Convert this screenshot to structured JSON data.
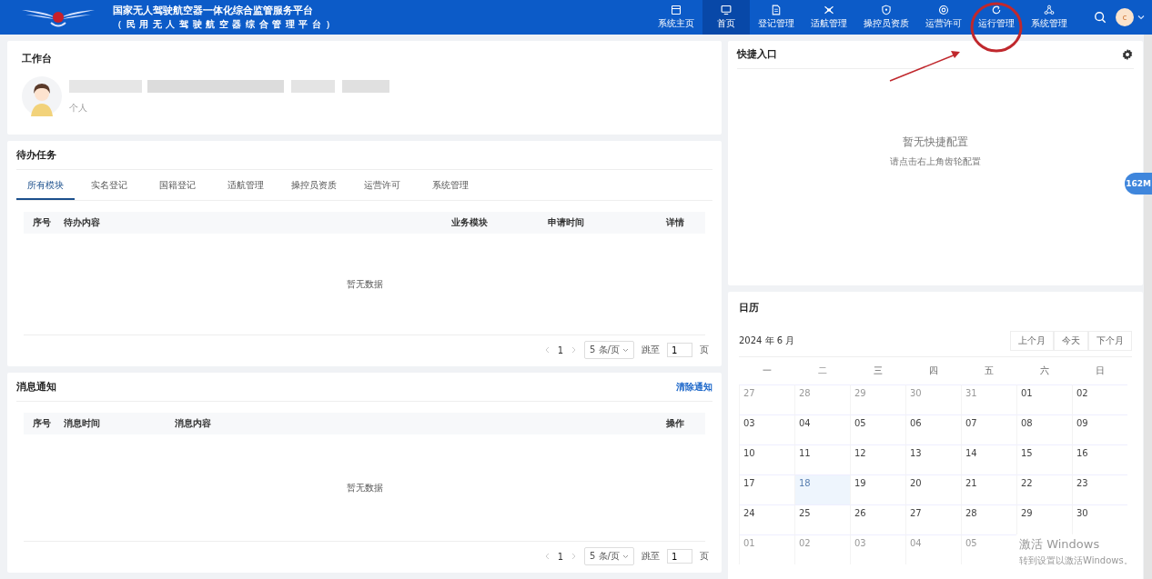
{
  "header": {
    "title": "国家无人驾驶航空器一体化综合监管服务平台",
    "subtitle": "（民用无人驾驶航空器综合管理平台）",
    "nav": [
      {
        "label": "系统主页",
        "selected": false
      },
      {
        "label": "首页",
        "selected": true
      },
      {
        "label": "登记管理",
        "selected": false
      },
      {
        "label": "适航管理",
        "selected": false
      },
      {
        "label": "操控员资质",
        "selected": false
      },
      {
        "label": "运营许可",
        "selected": false
      },
      {
        "label": "运行管理",
        "selected": false
      },
      {
        "label": "系统管理",
        "selected": false
      }
    ],
    "avatar": "c"
  },
  "workbench": {
    "title": "工作台",
    "role": "个人"
  },
  "todo": {
    "title": "待办任务",
    "tabs": [
      {
        "label": "所有模块",
        "selected": true
      },
      {
        "label": "实名登记",
        "selected": false
      },
      {
        "label": "国籍登记",
        "selected": false
      },
      {
        "label": "适航管理",
        "selected": false
      },
      {
        "label": "操控员资质",
        "selected": false
      },
      {
        "label": "运营许可",
        "selected": false
      },
      {
        "label": "系统管理",
        "selected": false
      }
    ],
    "columns": [
      "序号",
      "待办内容",
      "业务模块",
      "申请时间",
      "详情"
    ],
    "empty": "暂无数据",
    "pagination": {
      "page": "1",
      "page_size": "5 条/页",
      "jump_label": "跳至",
      "jump_value": "1",
      "unit": "页"
    }
  },
  "messages": {
    "title": "消息通知",
    "action": "清除通知",
    "columns": [
      "序号",
      "消息时间",
      "消息内容",
      "操作"
    ],
    "empty": "暂无数据",
    "pagination": {
      "page": "1",
      "page_size": "5 条/页",
      "jump_label": "跳至",
      "jump_value": "1",
      "unit": "页"
    }
  },
  "shortcuts": {
    "title": "快捷入口",
    "empty_title": "暂无快捷配置",
    "empty_hint": "请点击右上角齿轮配置"
  },
  "calendar": {
    "title": "日历",
    "month": "2024 年 6 月",
    "buttons": [
      "上个月",
      "今天",
      "下个月"
    ],
    "weekdays": [
      "一",
      "二",
      "三",
      "四",
      "五",
      "六",
      "日"
    ],
    "weeks": [
      [
        {
          "day": "27",
          "outside": true,
          "selected": false
        },
        {
          "day": "28",
          "outside": true,
          "selected": false
        },
        {
          "day": "29",
          "outside": true,
          "selected": false
        },
        {
          "day": "30",
          "outside": true,
          "selected": false
        },
        {
          "day": "31",
          "outside": true,
          "selected": false
        },
        {
          "day": "01",
          "outside": false,
          "selected": false
        },
        {
          "day": "02",
          "outside": false,
          "selected": false
        }
      ],
      [
        {
          "day": "03",
          "outside": false,
          "selected": false
        },
        {
          "day": "04",
          "outside": false,
          "selected": false
        },
        {
          "day": "05",
          "outside": false,
          "selected": false
        },
        {
          "day": "06",
          "outside": false,
          "selected": false
        },
        {
          "day": "07",
          "outside": false,
          "selected": false
        },
        {
          "day": "08",
          "outside": false,
          "selected": false
        },
        {
          "day": "09",
          "outside": false,
          "selected": false
        }
      ],
      [
        {
          "day": "10",
          "outside": false,
          "selected": false
        },
        {
          "day": "11",
          "outside": false,
          "selected": false
        },
        {
          "day": "12",
          "outside": false,
          "selected": false
        },
        {
          "day": "13",
          "outside": false,
          "selected": false
        },
        {
          "day": "14",
          "outside": false,
          "selected": false
        },
        {
          "day": "15",
          "outside": false,
          "selected": false
        },
        {
          "day": "16",
          "outside": false,
          "selected": false
        }
      ],
      [
        {
          "day": "17",
          "outside": false,
          "selected": false
        },
        {
          "day": "18",
          "outside": false,
          "selected": true
        },
        {
          "day": "19",
          "outside": false,
          "selected": false
        },
        {
          "day": "20",
          "outside": false,
          "selected": false
        },
        {
          "day": "21",
          "outside": false,
          "selected": false
        },
        {
          "day": "22",
          "outside": false,
          "selected": false
        },
        {
          "day": "23",
          "outside": false,
          "selected": false
        }
      ],
      [
        {
          "day": "24",
          "outside": false,
          "selected": false
        },
        {
          "day": "25",
          "outside": false,
          "selected": false
        },
        {
          "day": "26",
          "outside": false,
          "selected": false
        },
        {
          "day": "27",
          "outside": false,
          "selected": false
        },
        {
          "day": "28",
          "outside": false,
          "selected": false
        },
        {
          "day": "29",
          "outside": false,
          "selected": false
        },
        {
          "day": "30",
          "outside": false,
          "selected": false
        }
      ],
      [
        {
          "day": "01",
          "outside": true,
          "selected": false
        },
        {
          "day": "02",
          "outside": true,
          "selected": false
        },
        {
          "day": "03",
          "outside": true,
          "selected": false
        },
        {
          "day": "04",
          "outside": true,
          "selected": false
        },
        {
          "day": "05",
          "outside": true,
          "selected": false
        }
      ]
    ]
  },
  "memory_badge": "162M",
  "os_notice": {
    "title": "激活 Windows",
    "text": "转到设置以激活Windows。"
  }
}
